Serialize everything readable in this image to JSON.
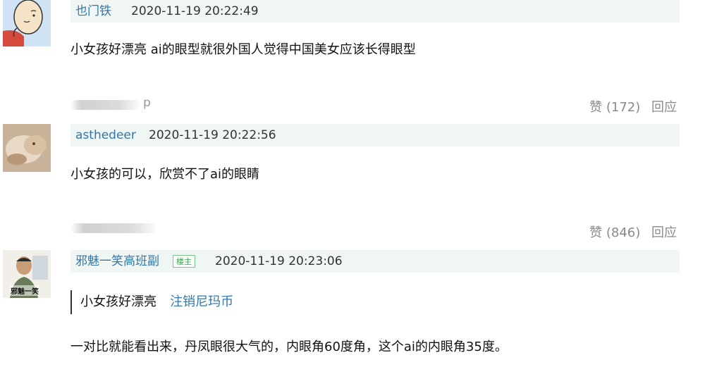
{
  "comments": [
    {
      "author": "也门铁",
      "time": "2020-11-19 20:22:49",
      "text": "小女孩好漂亮 ai的眼型就很外国人觉得中国美女应该长得眼型",
      "reply_user_blurred_tail": "p",
      "likes": "赞 (172)",
      "reply": "回应"
    },
    {
      "author": "asthedeer",
      "time": "2020-11-19 20:22:56",
      "text": "小女孩的可以，欣赏不了ai的眼睛",
      "reply_user_blurred_tail": "",
      "likes": "赞 (846)",
      "reply": "回应"
    },
    {
      "author": "邪魅一笑高班副",
      "badge": "楼主",
      "time": "2020-11-19 20:23:06",
      "quote_text": "小女孩好漂亮",
      "quote_author": "注销尼玛币",
      "text": "一对比就能看出来，丹凤眼很大气的，内眼角60度角，这个ai的内眼角35度。",
      "avatar_caption": "邪魅一笑"
    }
  ],
  "colors": {
    "link": "#3377aa",
    "meta_bg": "#f0f6f3",
    "badge": "#3ea353"
  }
}
